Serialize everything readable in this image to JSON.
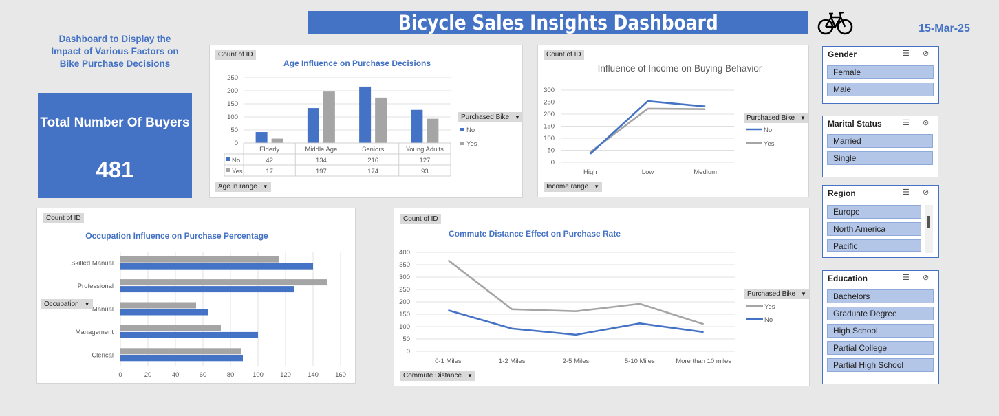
{
  "header": {
    "title": "Bicycle Sales Insights Dashboard",
    "date": "15-Mar-25",
    "icon": "bicycle-icon",
    "subtitle_lines": [
      "Dashboard to Display the",
      "Impact of Various Factors on",
      "Bike Purchase Decisions"
    ]
  },
  "kpi": {
    "label": "Total Number Of Buyers",
    "value": "481"
  },
  "colors": {
    "accent": "#4472c4",
    "grey": "#a5a5a5"
  },
  "pivot_buttons": {
    "count_of_id": "Count of ID",
    "purchased_bike": "Purchased Bike",
    "age_in_range": "Age in range",
    "income_range": "Income range",
    "occupation": "Occupation",
    "commute_distance": "Commute Distance"
  },
  "slicers": {
    "gender": {
      "title": "Gender",
      "items": [
        "Female",
        "Male"
      ]
    },
    "marital": {
      "title": "Marital Status",
      "items": [
        "Married",
        "Single"
      ]
    },
    "region": {
      "title": "Region",
      "items": [
        "Europe",
        "North America",
        "Pacific"
      ]
    },
    "education": {
      "title": "Education",
      "items": [
        "Bachelors",
        "Graduate Degree",
        "High School",
        "Partial College",
        "Partial High School"
      ]
    }
  },
  "chart_data": [
    {
      "id": "age",
      "type": "bar",
      "title": "Age Influence on Purchase Decisions",
      "categories": [
        "Elderly",
        "Middle Age",
        "Seniors",
        "Young Adults"
      ],
      "series": [
        {
          "name": "No",
          "values": [
            42,
            134,
            216,
            127
          ],
          "color": "#4472c4"
        },
        {
          "name": "Yes",
          "values": [
            17,
            197,
            174,
            93
          ],
          "color": "#a5a5a5"
        }
      ],
      "yticks": [
        0,
        50,
        100,
        150,
        200,
        250
      ],
      "ylim": [
        0,
        250
      ],
      "legend_title": "Purchased Bike",
      "legend": "right",
      "grid": true
    },
    {
      "id": "income",
      "type": "line",
      "title": "Influence of Income on Buying Behavior",
      "categories": [
        "High",
        "Low",
        "Medium"
      ],
      "series": [
        {
          "name": "No",
          "values": [
            35,
            254,
            232
          ],
          "color": "#4472c4"
        },
        {
          "name": "Yes",
          "values": [
            42,
            223,
            221
          ],
          "color": "#a5a5a5"
        }
      ],
      "yticks": [
        0,
        50,
        100,
        150,
        200,
        250,
        300
      ],
      "ylim": [
        0,
        300
      ],
      "legend_title": "Purchased Bike",
      "legend": "right",
      "grid": true
    },
    {
      "id": "occupation",
      "type": "bar",
      "orientation": "horizontal",
      "title": "Occupation Influence on Purchase Percentage",
      "categories": [
        "Skilled Manual",
        "Professional",
        "Manual",
        "Management",
        "Clerical"
      ],
      "series": [
        {
          "name": "Yes",
          "values": [
            115,
            150,
            55,
            73,
            88
          ],
          "color": "#a5a5a5"
        },
        {
          "name": "No",
          "values": [
            140,
            126,
            64,
            100,
            89
          ],
          "color": "#4472c4"
        }
      ],
      "xticks": [
        0,
        20,
        40,
        60,
        80,
        100,
        120,
        140,
        160
      ],
      "xlim": [
        0,
        160
      ],
      "grid": true
    },
    {
      "id": "commute",
      "type": "line",
      "title": "Commute Distance Effect on Purchase Rate",
      "categories": [
        "0-1 Miles",
        "1-2 Miles",
        "2-5 Miles",
        "5-10 Miles",
        "More than 10 miles"
      ],
      "series": [
        {
          "name": "Yes",
          "values": [
            368,
            170,
            162,
            192,
            110
          ],
          "color": "#a5a5a5"
        },
        {
          "name": "No",
          "values": [
            166,
            92,
            67,
            113,
            78
          ],
          "color": "#4472c4"
        }
      ],
      "yticks": [
        0,
        50,
        100,
        150,
        200,
        250,
        300,
        350,
        400
      ],
      "ylim": [
        0,
        400
      ],
      "legend_title": "Purchased Bike",
      "legend": "right",
      "grid": true
    }
  ]
}
